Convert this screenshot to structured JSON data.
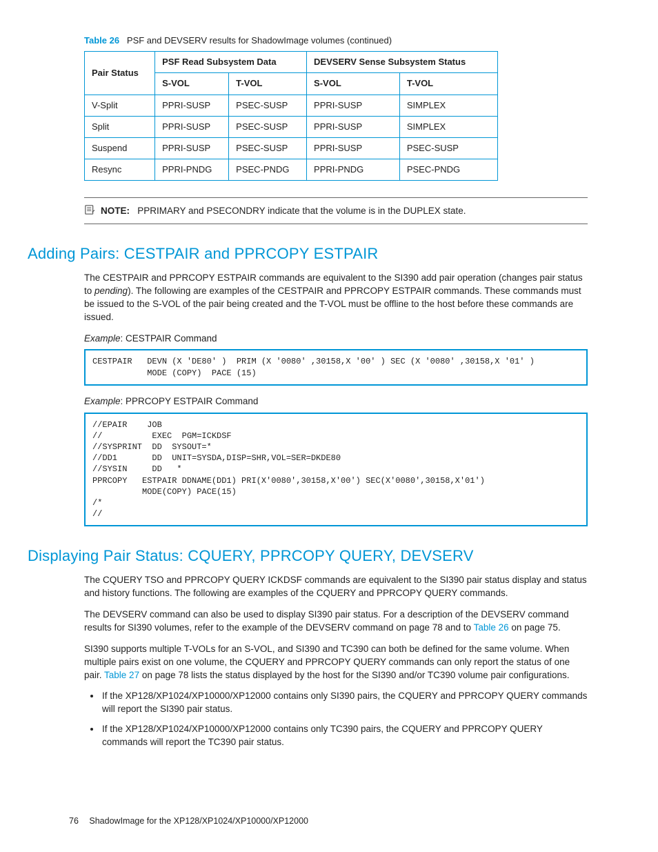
{
  "table": {
    "label": "Table 26",
    "caption": "PSF and DEVSERV results for ShadowImage volumes (continued)",
    "head_col1": "Pair Status",
    "head_group1": "PSF Read Subsystem Data",
    "head_group2": "DEVSERV Sense Subsystem Status",
    "sub_svol": "S-VOL",
    "sub_tvol": "T-VOL",
    "rows": [
      {
        "pair": "V-Split",
        "p_svol": "PPRI-SUSP",
        "p_tvol": "PSEC-SUSP",
        "d_svol": "PPRI-SUSP",
        "d_tvol": "SIMPLEX"
      },
      {
        "pair": "Split",
        "p_svol": "PPRI-SUSP",
        "p_tvol": "PSEC-SUSP",
        "d_svol": "PPRI-SUSP",
        "d_tvol": "SIMPLEX"
      },
      {
        "pair": "Suspend",
        "p_svol": "PPRI-SUSP",
        "p_tvol": "PSEC-SUSP",
        "d_svol": "PPRI-SUSP",
        "d_tvol": "PSEC-SUSP"
      },
      {
        "pair": "Resync",
        "p_svol": "PPRI-PNDG",
        "p_tvol": "PSEC-PNDG",
        "d_svol": "PPRI-PNDG",
        "d_tvol": "PSEC-PNDG"
      }
    ]
  },
  "note": {
    "label": "NOTE:",
    "text": "PPRIMARY and PSECONDRY indicate that the volume is in the DUPLEX state."
  },
  "section1": {
    "title": "Adding Pairs: CESTPAIR and PPRCOPY ESTPAIR",
    "p1a": "The CESTPAIR and PPRCOPY ESTPAIR commands are equivalent to the SI390 add pair operation (changes pair status to ",
    "p1_pending": "pending",
    "p1b": "). The following are examples of the CESTPAIR and PPRCOPY ESTPAIR commands. These commands must be issued to the S-VOL of the pair being created and the T-VOL must be offline to the host before these commands are issued.",
    "ex1_label": "Example",
    "ex1_text": ": CESTPAIR Command",
    "code1": "CESTPAIR   DEVN (X 'DE80' )  PRIM (X '0080' ,30158,X '00' ) SEC (X '0080' ,30158,X '01' )\n           MODE (COPY)  PACE (15)",
    "ex2_label": "Example",
    "ex2_text": ": PPRCOPY ESTPAIR Command",
    "code2": "//EPAIR    JOB\n//          EXEC  PGM=ICKDSF\n//SYSPRINT  DD  SYSOUT=*\n//DD1       DD  UNIT=SYSDA,DISP=SHR,VOL=SER=DKDE80\n//SYSIN     DD   *\nPPRCOPY   ESTPAIR DDNAME(DD1) PRI(X'0080',30158,X'00') SEC(X'0080',30158,X'01')\n          MODE(COPY) PACE(15)\n/*\n//"
  },
  "section2": {
    "title": "Displaying Pair Status: CQUERY, PPRCOPY QUERY, DEVSERV",
    "p1": "The CQUERY TSO and PPRCOPY QUERY ICKDSF commands are equivalent to the SI390 pair status display and status and history functions. The following are examples of the CQUERY and PPRCOPY QUERY commands.",
    "p2a": "The DEVSERV command can also be used to display SI390 pair status. For a description of the DEVSERV command results for SI390 volumes, refer to the example of the DEVSERV command on page 78 and to ",
    "p2_link": "Table 26",
    "p2b": " on page 75.",
    "p3a": "SI390 supports multiple T-VOLs for an S-VOL, and SI390 and TC390 can both be defined for the same volume. When multiple pairs exist on one volume, the CQUERY and PPRCOPY QUERY commands can only report the status of one pair. ",
    "p3_link": "Table 27",
    "p3b": " on page 78 lists the status displayed by the host for the SI390 and/or TC390 volume pair configurations.",
    "bullets": [
      "If the XP128/XP1024/XP10000/XP12000 contains only SI390 pairs, the CQUERY and PPRCOPY QUERY commands will report the SI390 pair status.",
      "If the XP128/XP1024/XP10000/XP12000 contains only TC390 pairs, the CQUERY and PPRCOPY QUERY commands will report the TC390 pair status."
    ]
  },
  "footer": {
    "page": "76",
    "title": "ShadowImage for the XP128/XP1024/XP10000/XP12000"
  }
}
